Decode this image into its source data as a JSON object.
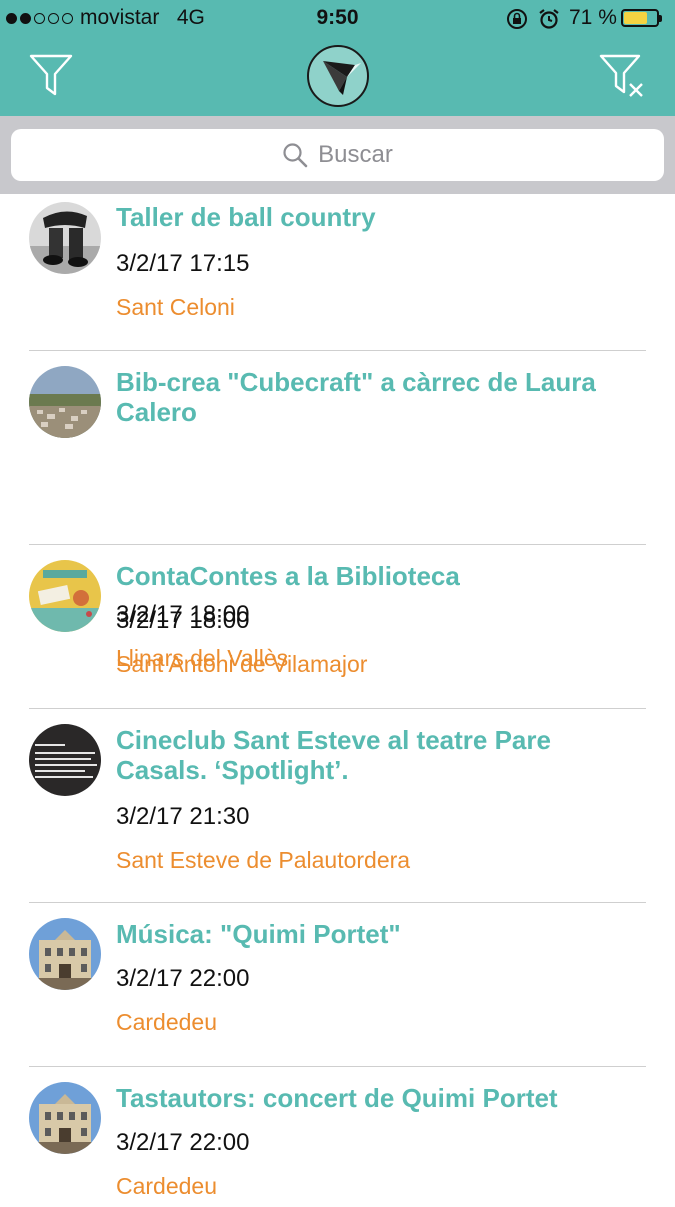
{
  "status_bar": {
    "carrier": "movistar",
    "network": "4G",
    "time": "9:50",
    "battery_text": "71 %",
    "battery_level": 0.71
  },
  "nav": {
    "left_icon": "filter-icon",
    "right_icon": "filter-clear-icon",
    "logo_icon": "app-logo-icon"
  },
  "search": {
    "placeholder": "Buscar"
  },
  "events": [
    {
      "title": "Taller de ball country",
      "datetime": "3/2/17 17:15",
      "place": "Sant Celoni",
      "thumb": "bw-boots"
    },
    {
      "title": "Bib-crea \"Cubecraft\" a càrrec de Laura Calero",
      "datetime": "3/2/17 18:00",
      "place": "Llinars del Vallès",
      "thumb": "aerial-town"
    },
    {
      "title": "ContaContes a la Biblioteca",
      "datetime": "3/2/17 18:00",
      "place": "Sant Antoni de Vilamajor",
      "thumb": "poster-yellow"
    },
    {
      "title": "Cineclub Sant Esteve al teatre Pare Casals. ‘Spotlight’.",
      "datetime": "3/2/17 21:30",
      "place": "Sant Esteve de Palautordera",
      "thumb": "dark-text"
    },
    {
      "title": "Música: \"Quimi Portet\"",
      "datetime": "3/2/17 22:00",
      "place": "Cardedeu",
      "thumb": "building"
    },
    {
      "title": "Tastautors: concert de Quimi Portet",
      "datetime": "3/2/17 22:00",
      "place": "Cardedeu",
      "thumb": "building"
    }
  ],
  "colors": {
    "accent": "#58bab1",
    "place": "#ec8d2f",
    "search_bg": "#c8c8cc"
  }
}
